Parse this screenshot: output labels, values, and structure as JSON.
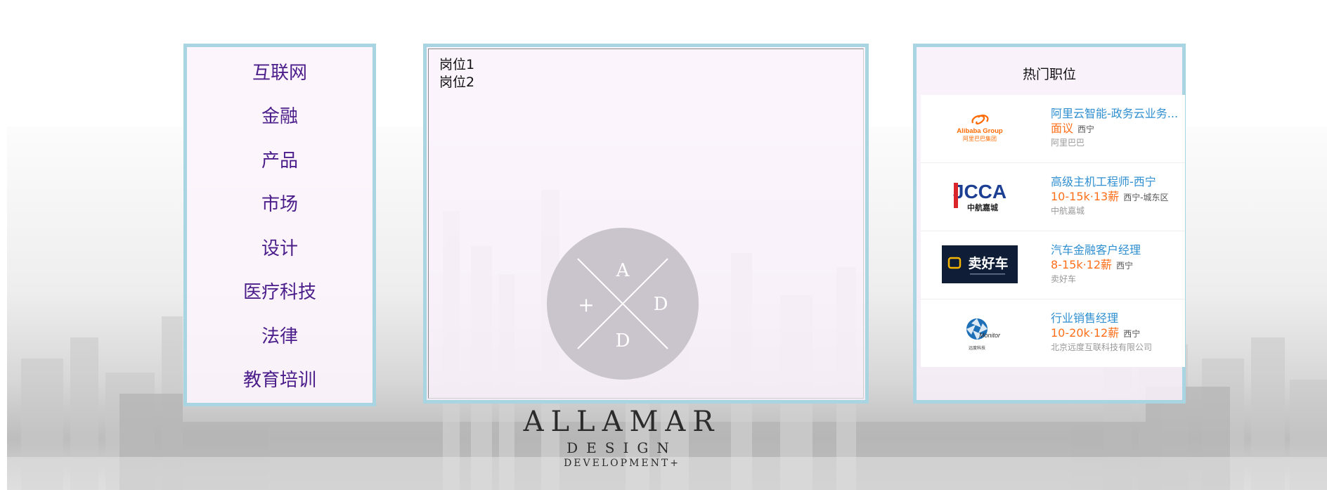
{
  "categories": [
    {
      "label": "互联网"
    },
    {
      "label": "金融"
    },
    {
      "label": "产品"
    },
    {
      "label": "市场"
    },
    {
      "label": "设计"
    },
    {
      "label": "医疗科技"
    },
    {
      "label": "法律"
    },
    {
      "label": "教育培训"
    }
  ],
  "positions": [
    {
      "label": "岗位1"
    },
    {
      "label": "岗位2"
    }
  ],
  "center_logo": {
    "letters": [
      "A",
      "D",
      "D",
      "+"
    ]
  },
  "brand": {
    "line1": "ALLAMAR",
    "line2": "DESIGN",
    "line3": "DEVELOPMENT",
    "mark": "+"
  },
  "hot_jobs": {
    "title": "热门职位",
    "items": [
      {
        "title": "阿里云智能-政务云业务...",
        "salary": "面议",
        "location": "西宁",
        "company": "阿里巴巴",
        "logo": {
          "line1": "Alibaba Group",
          "line2": "阿里巴巴集团"
        }
      },
      {
        "title": "高级主机工程师-西宁",
        "salary": "10-15k·13薪",
        "location": "西宁-城东区",
        "company": "中航嘉城",
        "logo": {
          "line1": "JCCA",
          "line2": "中航嘉城"
        }
      },
      {
        "title": "汽车金融客户经理",
        "salary": "8-15k·12薪",
        "location": "西宁",
        "company": "卖好车",
        "logo": {
          "line1": "卖好车"
        }
      },
      {
        "title": "行业销售经理",
        "salary": "10-20k·12薪",
        "location": "西宁",
        "company": "北京远度互联科技有限公司",
        "logo": {
          "line1": "Monitor",
          "line2": "远度科技"
        }
      }
    ]
  },
  "colors": {
    "panel_border": "#a9d4e2",
    "category_text": "#4b1d8a",
    "job_title": "#2f8fd0",
    "salary": "#ff6f1a"
  }
}
